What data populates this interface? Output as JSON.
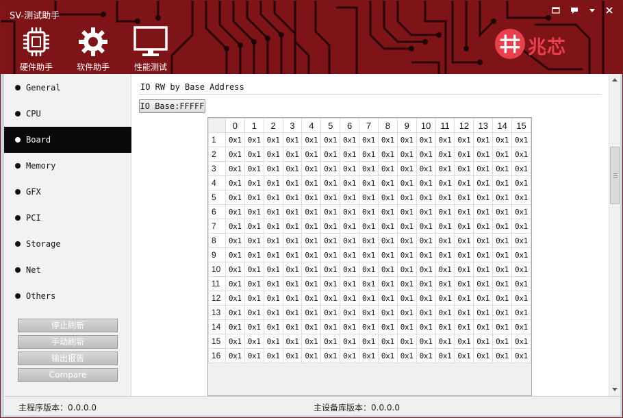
{
  "window": {
    "title": "SV-测试助手",
    "controls": {
      "skin": "▭",
      "feedback": "▪",
      "minimize": "▾",
      "close": "✕"
    }
  },
  "toolbar": {
    "tools": [
      {
        "label": "硬件助手",
        "icon": "chip-icon"
      },
      {
        "label": "软件助手",
        "icon": "gear-icon"
      },
      {
        "label": "性能测试",
        "icon": "monitor-icon"
      }
    ],
    "brand_text": "兆芯",
    "brand_logo": "zhaoxin-logo"
  },
  "sidebar": {
    "items": [
      {
        "label": "General"
      },
      {
        "label": "CPU"
      },
      {
        "label": "Board",
        "active": true
      },
      {
        "label": "Memory"
      },
      {
        "label": "GFX"
      },
      {
        "label": "PCI"
      },
      {
        "label": "Storage"
      },
      {
        "label": "Net"
      },
      {
        "label": "Others"
      }
    ],
    "buttons": {
      "stop_refresh": "停止刷新",
      "manual_refresh": "手动刷新",
      "export_report": "输出报告",
      "compare": "Compare"
    }
  },
  "main": {
    "section_title": "IO RW by Base Address",
    "base_button": "IO Base:FFFFF",
    "grid": {
      "columns": [
        "0",
        "1",
        "2",
        "3",
        "4",
        "5",
        "6",
        "7",
        "8",
        "9",
        "10",
        "11",
        "12",
        "13",
        "14",
        "15"
      ],
      "rows": [
        "1",
        "2",
        "3",
        "4",
        "5",
        "6",
        "7",
        "8",
        "9",
        "10",
        "11",
        "12",
        "13",
        "14",
        "15",
        "16"
      ],
      "cell_value": "0x1"
    }
  },
  "statusbar": {
    "main_version": "主程序版本：0.0.0.0",
    "device_lib_version": "主设备库版本：0.0.0.0"
  },
  "colors": {
    "header_red": "#7e1418",
    "brand_red": "#e8404c",
    "active_nav": "#0a0a0a"
  }
}
